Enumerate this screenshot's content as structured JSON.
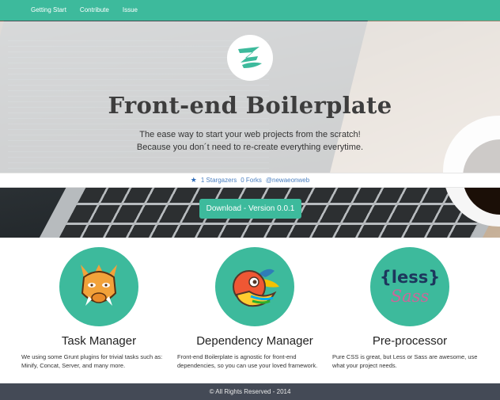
{
  "nav": {
    "items": [
      "Getting Start",
      "Contribute",
      "Issue"
    ]
  },
  "hero": {
    "title": "Front-end Boilerplate",
    "subtitle_line1": "The ease way to start your web projects from the scratch!",
    "subtitle_line2": "Because you don´t need to re-create everything everytime.",
    "logo_icon": "z-logo-icon"
  },
  "stats": {
    "stargazers": "1 Stargazers",
    "forks": "0 Forks",
    "handle": "@newaeonweb"
  },
  "download": {
    "label": "Download - Version 0.0.1"
  },
  "features": [
    {
      "icon": "grunt-boar-icon",
      "title": "Task Manager",
      "description": "We using some Grunt plugins for trivial tasks such as: Minify, Concat, Server, and many more."
    },
    {
      "icon": "bower-bird-icon",
      "title": "Dependency Manager",
      "description": "Front-end Boilerplate is agnostic for front-end dependencies, so you can use your loved framework."
    },
    {
      "icon": "less-sass-icon",
      "title": "Pre-processor",
      "description": "Pure CSS is great, but Less or Sass are awesome, use what your project needs.",
      "logo_text_1": "{less}",
      "logo_text_2": "Sass"
    }
  ],
  "footer": {
    "text": "© All Rights Reserved - 2014"
  },
  "colors": {
    "accent": "#3dba9c",
    "footer": "#444a56",
    "link": "#4a7fc0"
  }
}
